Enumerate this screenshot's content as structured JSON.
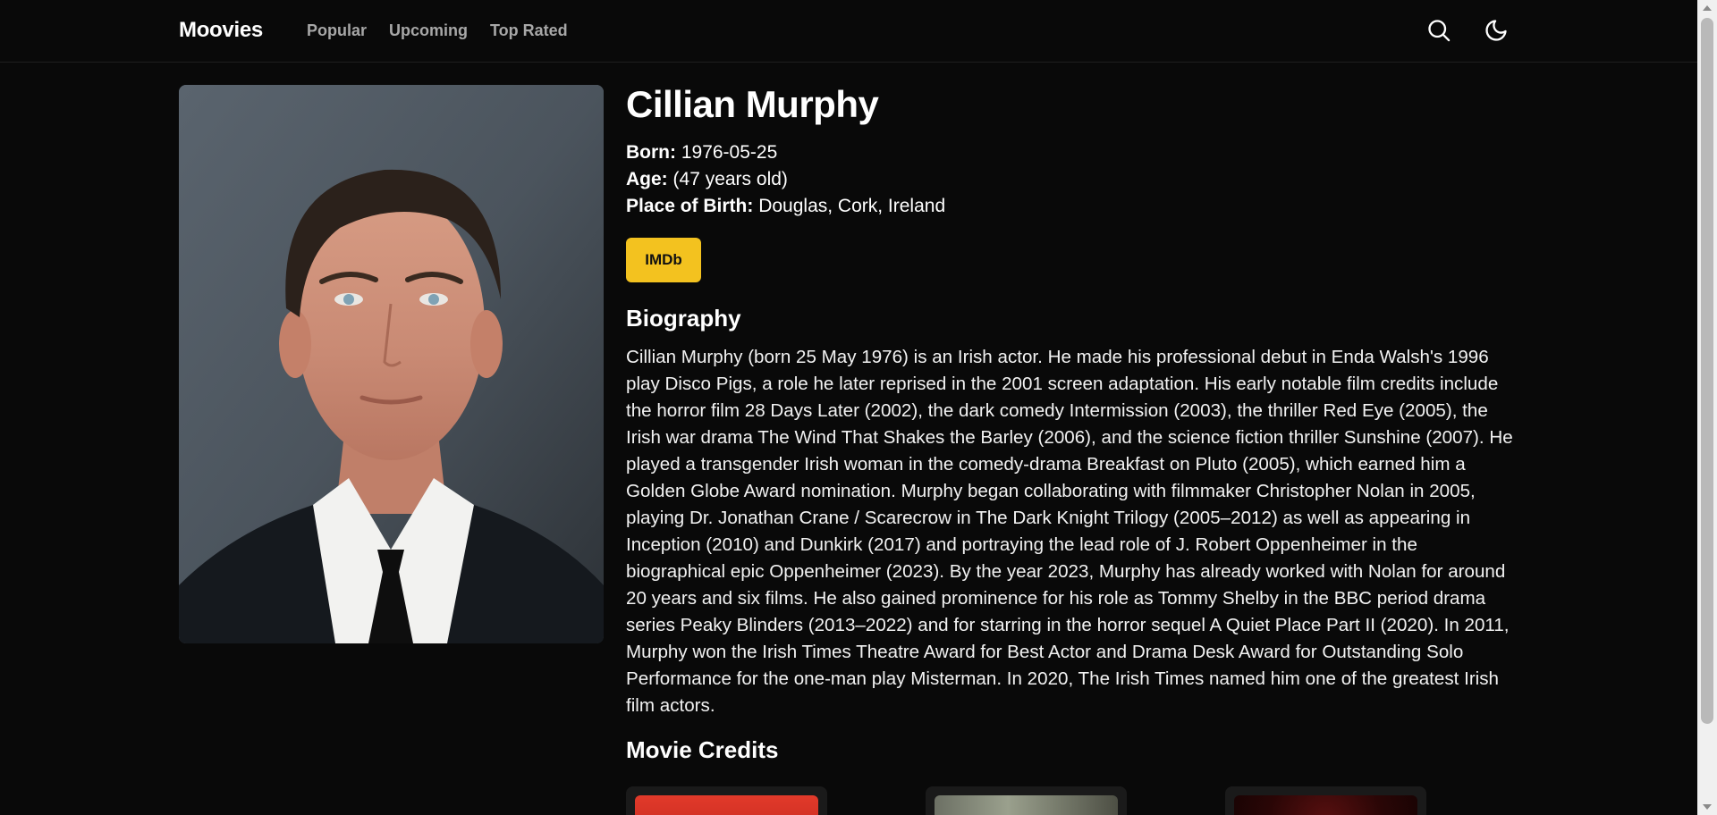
{
  "nav": {
    "brand": "Moovies",
    "links": [
      "Popular",
      "Upcoming",
      "Top Rated"
    ],
    "search_icon": "search-icon",
    "theme_icon": "moon-icon"
  },
  "person": {
    "name": "Cillian Murphy",
    "born_label": "Born:",
    "born": "1976-05-25",
    "age_label": "Age:",
    "age": "(47 years old)",
    "birthplace_label": "Place of Birth:",
    "birthplace": "Douglas, Cork, Ireland",
    "imdb_label": "IMDb"
  },
  "biography": {
    "title": "Biography",
    "text": "Cillian Murphy (born 25 May 1976) is an Irish actor. He made his professional debut in Enda Walsh's 1996 play Disco Pigs, a role he later reprised in the 2001 screen adaptation. His early notable film credits include the horror film 28 Days Later (2002), the dark comedy Intermission (2003), the thriller Red Eye (2005), the Irish war drama The Wind That Shakes the Barley (2006), and the science fiction thriller Sunshine (2007). He played a transgender Irish woman in the comedy-drama Breakfast on Pluto (2005), which earned him a Golden Globe Award nomination. Murphy began collaborating with filmmaker Christopher Nolan in 2005, playing Dr. Jonathan Crane / Scarecrow in The Dark Knight Trilogy (2005–2012) as well as appearing in Inception (2010) and Dunkirk (2017) and portraying the lead role of J. Robert Oppenheimer in the biographical epic Oppenheimer (2023). By the year 2023, Murphy has already worked with Nolan for around 20 years and six films. He also gained prominence for his role as Tommy Shelby in the BBC period drama series Peaky Blinders (2013–2022) and for starring in the horror sequel A Quiet Place Part II (2020). In 2011, Murphy won the Irish Times Theatre Award for Best Actor and Drama Desk Award for Outstanding Solo Performance for the one-man play Misterman. In 2020, The Irish Times named him one of the greatest Irish film actors."
  },
  "credits": {
    "title": "Movie Credits"
  },
  "colors": {
    "background": "#090909",
    "imdb": "#f3c21f",
    "nav_link": "#a7a7a7"
  }
}
